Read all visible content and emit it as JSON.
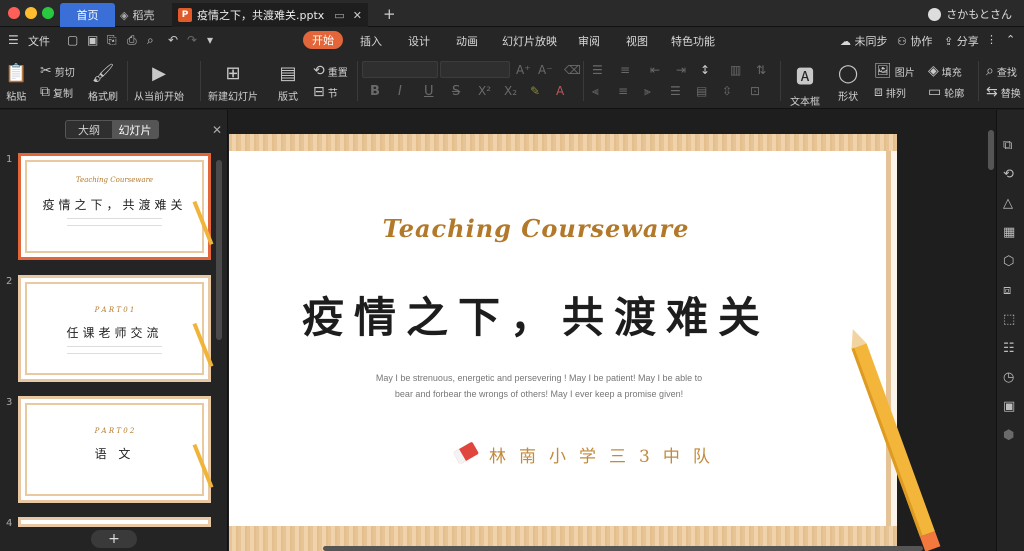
{
  "tabs": {
    "home": "首页",
    "docer": "稻壳",
    "document": "疫情之下，共渡难关.pptx",
    "user": "さかもとさん"
  },
  "menu": {
    "file": "文件",
    "items": [
      "开始",
      "插入",
      "设计",
      "动画",
      "幻灯片放映",
      "审阅",
      "视图",
      "特色功能"
    ],
    "sync": "未同步",
    "collab": "协作",
    "share": "分享"
  },
  "ribbon": {
    "paste": "粘贴",
    "cut": "剪切",
    "copy": "复制",
    "format_painter": "格式刷",
    "play_from_current": "从当前开始",
    "new_slide": "新建幻灯片",
    "layout": "版式",
    "reset": "重置",
    "section": "节",
    "textbox": "文本框",
    "shape": "形状",
    "picture": "图片",
    "arrange": "排列",
    "fill": "填充",
    "outline": "轮廓",
    "find": "查找",
    "replace": "替换"
  },
  "panel": {
    "outline": "大纲",
    "slides": "幻灯片"
  },
  "thumbnails": [
    {
      "num": "1",
      "top": "Teaching Courseware",
      "title": "疫情之下，共渡难关"
    },
    {
      "num": "2",
      "top": "P A R T  0 1",
      "title": "任课老师交流"
    },
    {
      "num": "3",
      "top": "P A R T  0 2",
      "title": "语      文"
    },
    {
      "num": "4",
      "top": "",
      "title": ""
    }
  ],
  "slide": {
    "title_en": "Teaching Courseware",
    "title_cn": "疫情之下，共渡难关",
    "body_line1": "May I be strenuous, energetic and persevering ! May I be patient! May I be able to",
    "body_line2": "bear and forbear the wrongs of others! May I ever keep a promise given!",
    "school": "林南小学三3中队"
  },
  "colors": {
    "accent": "#e2663a",
    "home_tab": "#3a6fd8",
    "title_gold": "#b3792a",
    "wood": "#e7c495"
  }
}
